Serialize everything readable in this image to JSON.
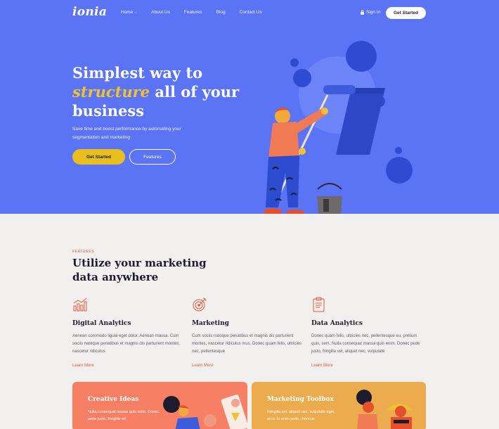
{
  "brand": {
    "logo": "ionia"
  },
  "nav": {
    "links": [
      "Home",
      "About Us",
      "Features",
      "Blog",
      "Contact Us"
    ],
    "signin": "Sign In",
    "cta": "Get Started"
  },
  "hero": {
    "title_line1": "Simplest way to",
    "title_highlight": "structure",
    "title_rest": "all of your",
    "title_line3": "business",
    "subtitle": "Save time and boost performance by automating your segmentation and marketing",
    "primary_button": "Get Started",
    "secondary_button": "Features"
  },
  "features_section": {
    "eyebrow": "FEATURES",
    "title": "Utilize your marketing data anywhere",
    "items": [
      {
        "icon": "chart-growth-icon",
        "title": "Digital Analytics",
        "desc": "Aenean commodo ligula eget dolor. Aenean massa. Cum sociis natoque penatibus et magnis dis parturient montes, nascetur ridiculus",
        "link": "Learn More"
      },
      {
        "icon": "target-icon",
        "title": "Marketing",
        "desc": "Cum sociis natoque penatibus et magnis dis parturient montes, nascetur ridiculus mus. Donec quam felis, ultricies nec, pellentesque",
        "link": "Learn More"
      },
      {
        "icon": "clipboard-icon",
        "title": "Data Analytics",
        "desc": "Donec quam felis, ultricies nec, pellentesque eu, pretium quis, sem. Nulla consequat massa quis enim. Donec pede justo, fringilla vel, aliquet nec, vulputate",
        "link": "Learn More"
      }
    ]
  },
  "cards": [
    {
      "title": "Creative Ideas",
      "desc": "Nulla consequat massa quis enim. Donec pede justo, fringilla vel",
      "color": "#f77f63"
    },
    {
      "title": "Marketing Toolbox",
      "desc": "Fringilla vel, aliquet nec, vulputate eget, arcu. In enim justo, rhoncus",
      "color": "#ecab4d"
    }
  ],
  "colors": {
    "hero_bg": "#5b74f6",
    "accent_yellow": "#e8bf1f",
    "accent_red": "#e2583a",
    "page_bg": "#f2f0ee"
  }
}
